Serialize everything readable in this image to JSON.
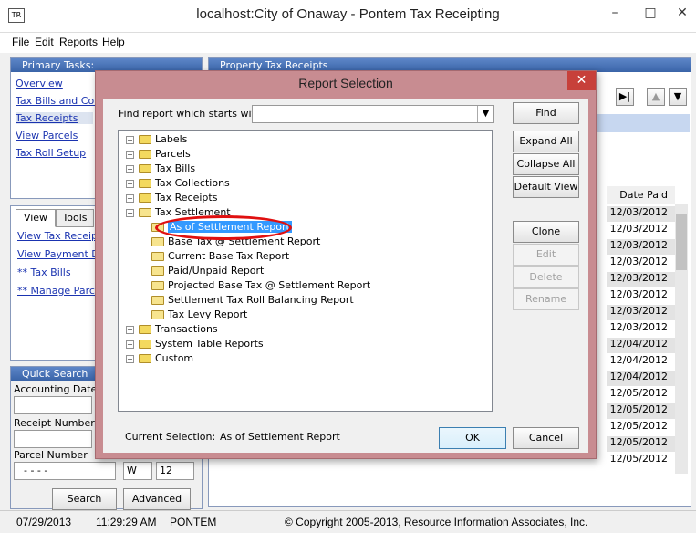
{
  "window": {
    "title": "localhost:City of Onaway - Pontem Tax Receipting",
    "logo": "TR",
    "minimize": "–",
    "maximize": "□",
    "close": "✕"
  },
  "menu": [
    "File",
    "Edit",
    "Reports",
    "Help"
  ],
  "primary_tasks": {
    "header": "Primary Tasks:",
    "items": [
      "Overview",
      "Tax Bills and Colle",
      "Tax Receipts",
      "View Parcels",
      "Tax Roll Setup"
    ]
  },
  "main_header": "Property Tax Receipts",
  "view_panel": {
    "tabs": [
      "View",
      "Tools"
    ],
    "links": [
      "View Tax Receipt",
      "View Payment Dis",
      "** Tax Bills",
      "** Manage Parcel"
    ]
  },
  "quick_search": {
    "header": "Quick Search",
    "accounting_date_label": "Accounting Date R",
    "receipt_number_label": "Receipt Number Ra",
    "parcel_number_label": "Parcel Number",
    "parcel_number_value": "-   -   -   -",
    "dir_value": "W",
    "num_value": "12",
    "search_button": "Search",
    "advanced_button": "Advanced"
  },
  "results_table": {
    "date_header": "Date Paid",
    "dates": [
      "12/03/2012",
      "12/03/2012",
      "12/03/2012",
      "12/03/2012",
      "12/03/2012",
      "12/03/2012",
      "12/03/2012",
      "12/03/2012",
      "12/04/2012",
      "12/04/2012",
      "12/04/2012",
      "12/05/2012",
      "12/05/2012",
      "12/05/2012",
      "12/05/2012",
      "12/05/2012"
    ]
  },
  "status_bar": {
    "date": "07/29/2013",
    "time": "11:29:29 AM",
    "user": "PONTEM",
    "copyright": "© Copyright 2005-2013, Resource Information Associates, Inc."
  },
  "dialog": {
    "title": "Report Selection",
    "close": "✕",
    "find_label": "Find report which starts with:",
    "find_value": "",
    "find_button": "Find",
    "expand_all_button": "Expand All",
    "collapse_all_button": "Collapse All",
    "default_view_button": "Default View",
    "clone_button": "Clone",
    "edit_button": "Edit",
    "delete_button": "Delete",
    "rename_button": "Rename",
    "ok_button": "OK",
    "cancel_button": "Cancel",
    "current_selection_label": "Current Selection:",
    "current_selection_value": "As of Settlement Report",
    "tree_top": [
      "Labels",
      "Parcels",
      "Tax Bills",
      "Tax Collections",
      "Tax Receipts"
    ],
    "tree_expanded": "Tax Settlement",
    "tree_children": [
      "As of Settlement Report",
      "Base Tax @ Settlement Report",
      "Current Base Tax Report",
      "Paid/Unpaid Report",
      "Projected Base Tax @ Settlement Report",
      "Settlement Tax Roll Balancing Report",
      "Tax Levy Report"
    ],
    "tree_bottom": [
      "Transactions",
      "System Table Reports",
      "Custom"
    ]
  }
}
